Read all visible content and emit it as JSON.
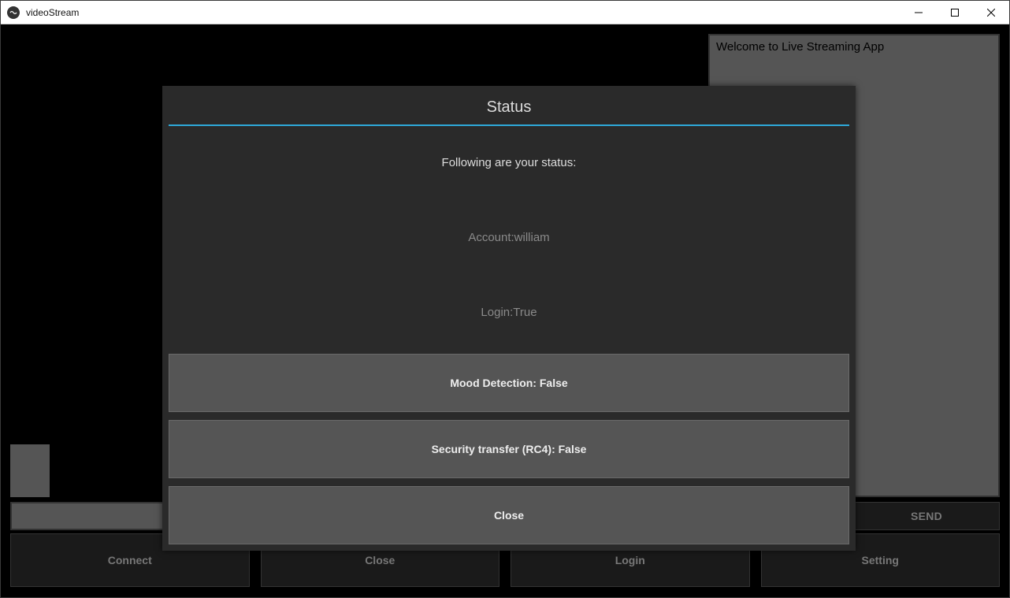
{
  "window": {
    "title": "videoStream"
  },
  "chat": {
    "welcome": "Welcome to Live Streaming App"
  },
  "send": {
    "label": "SEND"
  },
  "bottom": {
    "connect": "Connect",
    "close": "Close",
    "login": "Login",
    "setting": "Setting"
  },
  "modal": {
    "title": "Status",
    "intro": "Following are your status:",
    "account": "Account:william",
    "login": "Login:True",
    "mood": "Mood Detection: False",
    "security": "Security transfer (RC4): False",
    "close": "Close"
  }
}
